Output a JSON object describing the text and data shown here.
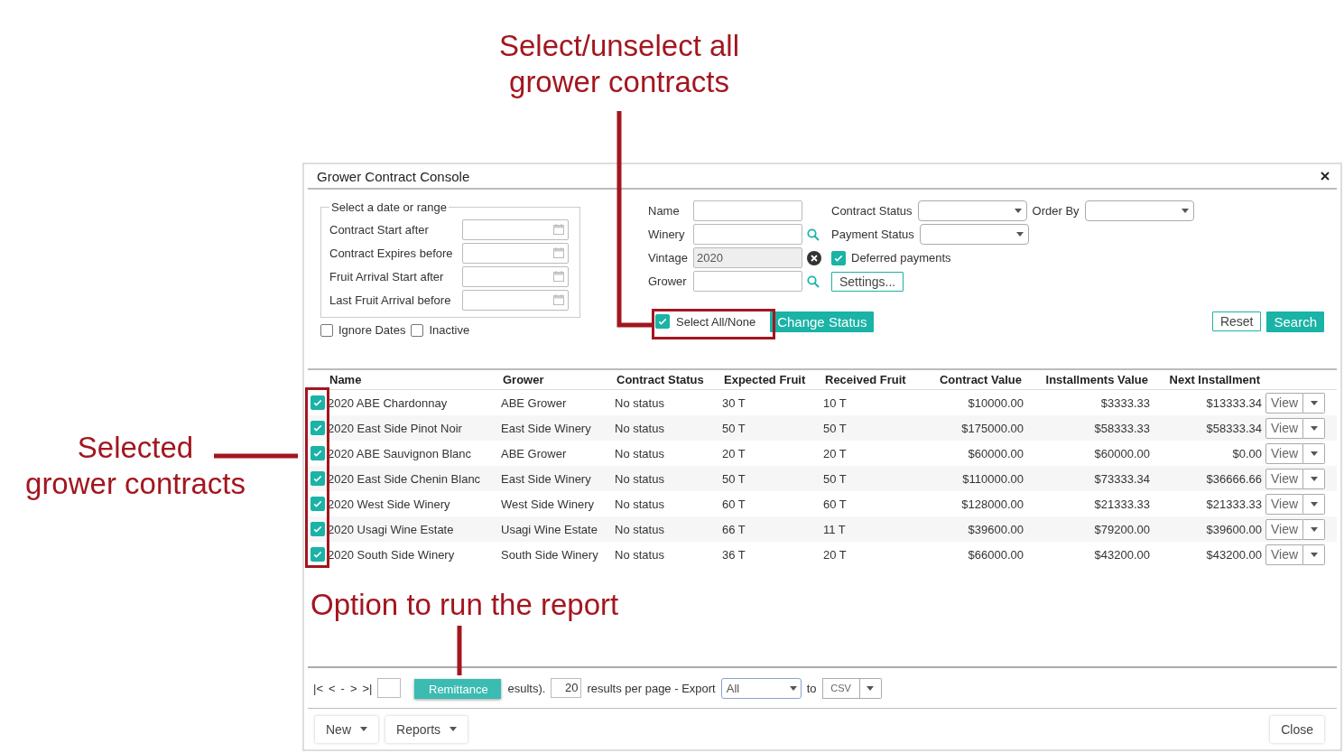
{
  "window": {
    "title": "Grower Contract Console"
  },
  "date_range": {
    "legend": "Select a date or range",
    "fields": [
      {
        "label": "Contract Start after"
      },
      {
        "label": "Contract Expires before"
      },
      {
        "label": "Fruit Arrival Start after"
      },
      {
        "label": "Last Fruit Arrival before"
      }
    ]
  },
  "date_options": [
    {
      "label": "Ignore Dates",
      "checked": false
    },
    {
      "label": "Inactive",
      "checked": false
    }
  ],
  "filters": [
    {
      "kind": "text",
      "label": "Name"
    },
    {
      "kind": "search",
      "label": "Winery"
    },
    {
      "kind": "clear",
      "label": "Vintage",
      "value": "2020"
    },
    {
      "kind": "search",
      "label": "Grower"
    }
  ],
  "selects": [
    {
      "label": "Contract Status"
    },
    {
      "label": "Order By"
    },
    {
      "label": "Payment Status"
    }
  ],
  "deferred_payments": {
    "label": "Deferred payments",
    "checked": true
  },
  "settings_button": "Settings...",
  "select_all": {
    "label": "Select All/None",
    "checked": true
  },
  "change_status_button": "Change Status",
  "reset_button": "Reset",
  "search_button": "Search",
  "table": {
    "columns": [
      "Name",
      "Grower",
      "Contract Status",
      "Expected Fruit",
      "Received Fruit",
      "Contract Value",
      "Installments Value",
      "Next Installment"
    ],
    "rows": [
      {
        "selected": true,
        "cells": [
          "2020 ABE Chardonnay",
          "ABE Grower",
          "No status",
          "30 T",
          "10 T",
          "$10000.00",
          "$3333.33",
          "$13333.34"
        ],
        "action": "View"
      },
      {
        "selected": true,
        "cells": [
          "2020 East Side Pinot Noir",
          "East Side Winery",
          "No status",
          "50 T",
          "50 T",
          "$175000.00",
          "$58333.33",
          "$58333.34"
        ],
        "action": "View"
      },
      {
        "selected": true,
        "cells": [
          "2020 ABE Sauvignon Blanc",
          "ABE Grower",
          "No status",
          "20 T",
          "20 T",
          "$60000.00",
          "$60000.00",
          "$0.00"
        ],
        "action": "View"
      },
      {
        "selected": true,
        "cells": [
          "2020 East Side Chenin Blanc",
          "East Side Winery",
          "No status",
          "50 T",
          "50 T",
          "$110000.00",
          "$73333.34",
          "$36666.66"
        ],
        "action": "View"
      },
      {
        "selected": true,
        "cells": [
          "2020 West Side Winery",
          "West Side Winery",
          "No status",
          "60 T",
          "60 T",
          "$128000.00",
          "$21333.33",
          "$21333.33"
        ],
        "action": "View"
      },
      {
        "selected": true,
        "cells": [
          "2020 Usagi Wine Estate",
          "Usagi Wine Estate",
          "No status",
          "66 T",
          "11 T",
          "$39600.00",
          "$79200.00",
          "$39600.00"
        ],
        "action": "View"
      },
      {
        "selected": true,
        "cells": [
          "2020 South Side Winery",
          "South Side Winery",
          "No status",
          "36 T",
          "20 T",
          "$66000.00",
          "$43200.00",
          "$43200.00"
        ],
        "action": "View"
      }
    ]
  },
  "pager": {
    "nav": [
      "|<",
      "<",
      "-",
      ">",
      ">|"
    ],
    "results_text": "esults).",
    "per_page": "20",
    "per_page_text": "results per page - Export",
    "export_scope": "All",
    "to_text": "to",
    "format": "CSV"
  },
  "report_menu": {
    "item": "Remittance"
  },
  "footer": {
    "menus": [
      "New",
      "Reports"
    ],
    "close": "Close"
  },
  "annotations": [
    {
      "kind": "select_all",
      "lines": [
        "Select/unselect all",
        "grower contracts"
      ]
    },
    {
      "kind": "rows",
      "lines": [
        "Selected",
        "grower contracts"
      ]
    },
    {
      "kind": "report",
      "lines": [
        "Option to run the report"
      ]
    }
  ]
}
